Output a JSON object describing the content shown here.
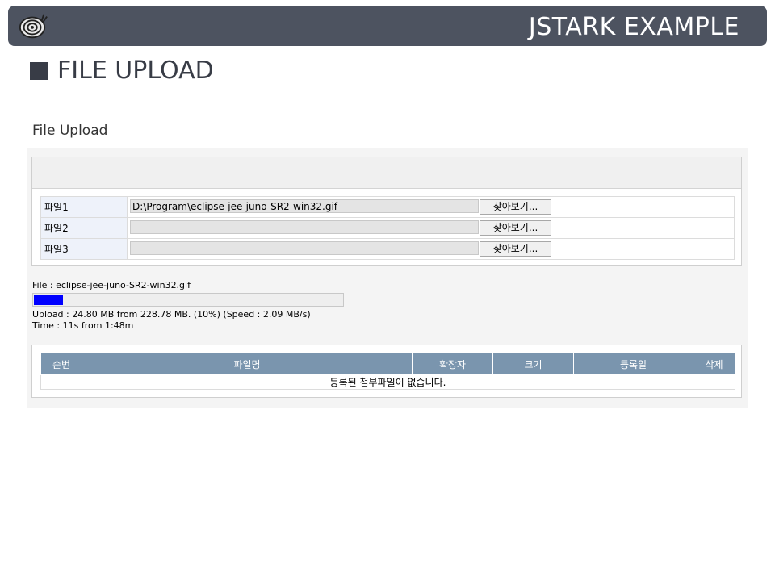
{
  "banner": {
    "title": "JSTARK EXAMPLE",
    "logo_icon": "snail-logo-icon"
  },
  "heading": {
    "text": "FILE UPLOAD"
  },
  "section_title": "File Upload",
  "files": [
    {
      "label": "파일1",
      "value": "D:\\Program\\eclipse-jee-juno-SR2-win32.gif",
      "button": "찾아보기..."
    },
    {
      "label": "파일2",
      "value": "",
      "button": "찾아보기..."
    },
    {
      "label": "파일3",
      "value": "",
      "button": "찾아보기..."
    }
  ],
  "progress": {
    "file_line": "File : eclipse-jee-juno-SR2-win32.gif",
    "percent": 10,
    "upload_line": "Upload : 24.80 MB from 228.78 MB. (10%) (Speed : 2.09 MB/s)",
    "time_line": "Time : 11s from 1:48m",
    "fill_color": "#0000ff"
  },
  "attachments": {
    "columns": [
      "순번",
      "파일명",
      "확장자",
      "크기",
      "등록일",
      "삭제"
    ],
    "empty_message": "등록된 첨부파일이 없습니다."
  },
  "colors": {
    "banner": "#4d5360",
    "table_header": "#7a95ae"
  }
}
